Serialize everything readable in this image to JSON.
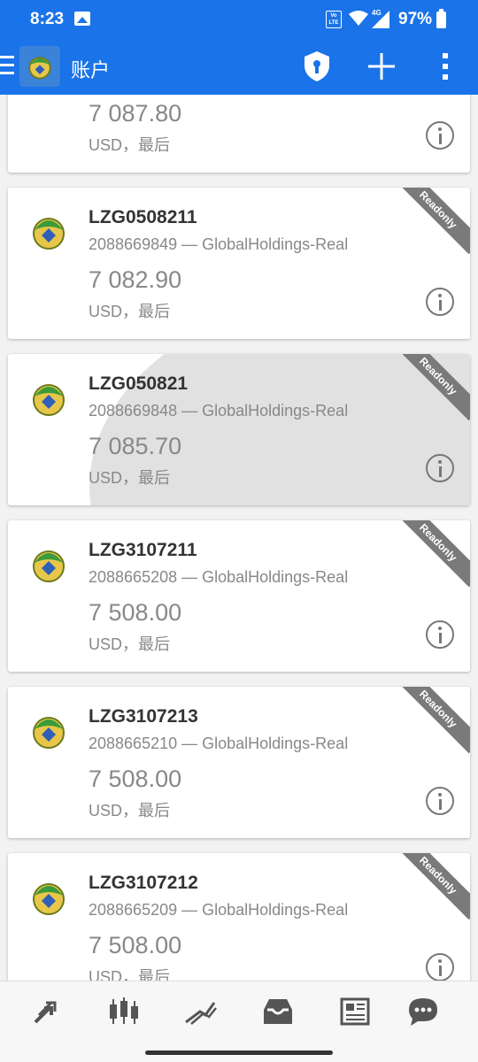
{
  "status_bar": {
    "time": "8:23",
    "volte": "Vo LTE",
    "network": "4G",
    "battery": "97%"
  },
  "app_bar": {
    "title": "账户",
    "icons": [
      "menu-icon",
      "app-logo",
      "shield-lock-icon",
      "plus-icon",
      "more-vertical-icon"
    ]
  },
  "accounts": [
    {
      "name": "",
      "server": "",
      "balance": "7 087.80",
      "currency": "USD，最后",
      "readonly": ""
    },
    {
      "name": "LZG0508211",
      "server": "2088669849 — GlobalHoldings-Real",
      "balance": "7 082.90",
      "currency": "USD，最后",
      "readonly": "Readonly"
    },
    {
      "name": "LZG050821",
      "server": "2088669848 — GlobalHoldings-Real",
      "balance": "7 085.70",
      "currency": "USD，最后",
      "readonly": "Readonly"
    },
    {
      "name": "LZG3107211",
      "server": "2088665208 — GlobalHoldings-Real",
      "balance": "7 508.00",
      "currency": "USD，最后",
      "readonly": "Readonly"
    },
    {
      "name": "LZG3107213",
      "server": "2088665210 — GlobalHoldings-Real",
      "balance": "7 508.00",
      "currency": "USD，最后",
      "readonly": "Readonly"
    },
    {
      "name": "LZG3107212",
      "server": "2088665209 — GlobalHoldings-Real",
      "balance": "7 508.00",
      "currency": "USD，最后",
      "readonly": "Readonly"
    }
  ],
  "bottom_nav": [
    "quotes-icon",
    "chart-icon",
    "trade-icon",
    "history-icon",
    "news-icon",
    "chat-icon"
  ],
  "colors": {
    "primary": "#1a73e8",
    "selected": "#e1e1e1",
    "ribbon": "#7a7a7a"
  }
}
